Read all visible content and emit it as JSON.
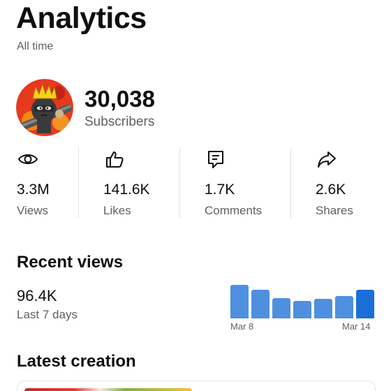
{
  "header": {
    "title": "Analytics",
    "subtitle": "All time"
  },
  "channel": {
    "avatar_icon": "channel-avatar-crowned-ninja",
    "subscriber_count": "30,038",
    "subscriber_label": "Subscribers"
  },
  "stats": [
    {
      "icon": "eye-icon",
      "value": "3.3M",
      "label": "Views"
    },
    {
      "icon": "thumbs-up-icon",
      "value": "141.6K",
      "label": "Likes"
    },
    {
      "icon": "comment-icon",
      "value": "1.7K",
      "label": "Comments"
    },
    {
      "icon": "share-icon",
      "value": "2.6K",
      "label": "Shares"
    }
  ],
  "recent_views": {
    "title": "Recent views",
    "value": "96.4K",
    "period": "Last 7 days"
  },
  "chart_data": {
    "type": "bar",
    "categories": [
      "",
      "",
      "",
      "",
      "",
      "",
      ""
    ],
    "x_labels": [
      "Mar 8",
      "Mar 14"
    ],
    "values": [
      0.92,
      0.78,
      0.55,
      0.48,
      0.54,
      0.62,
      0.78
    ],
    "grid": false,
    "colors": {
      "default": "#4f8fe0",
      "highlight": "#1a6fd8"
    }
  },
  "latest": {
    "title": "Latest creation"
  }
}
